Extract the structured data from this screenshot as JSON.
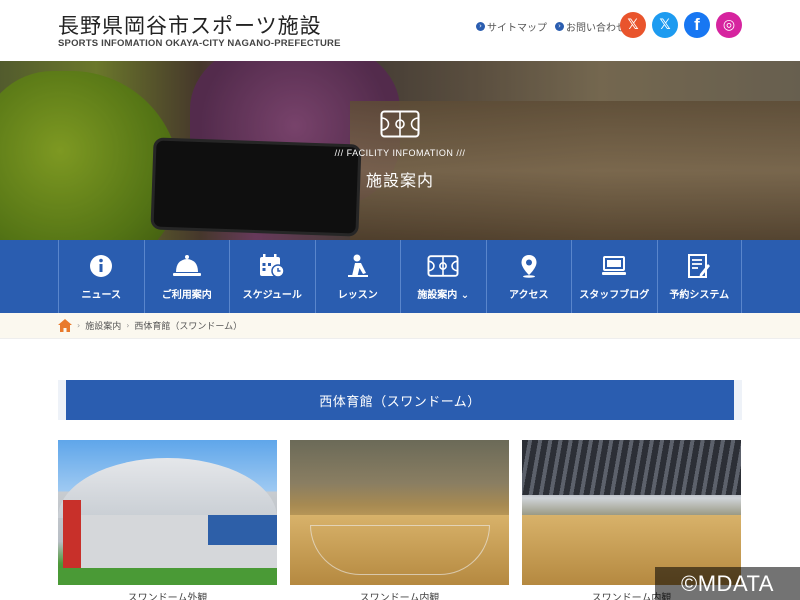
{
  "header": {
    "site_title": "長野県岡谷市スポーツ施設",
    "site_subtitle": "SPORTS INFOMATION OKAYA-CITY NAGANO-PREFECTURE",
    "links": [
      {
        "label": "サイトマップ"
      },
      {
        "label": "お問い合わせ"
      }
    ],
    "social": [
      {
        "icon": "x-icon",
        "glyph": "𝕏"
      },
      {
        "icon": "twitter-bird-icon",
        "glyph": "𝕏"
      },
      {
        "icon": "facebook-icon",
        "glyph": "f"
      },
      {
        "icon": "instagram-icon",
        "glyph": "◎"
      }
    ]
  },
  "hero": {
    "kicker": "FACILITY INFOMATION",
    "title": "施設案内"
  },
  "nav": {
    "items": [
      {
        "label": "ニュース",
        "icon": "info-icon"
      },
      {
        "label": "ご利用案内",
        "icon": "bell-icon"
      },
      {
        "label": "スケジュール",
        "icon": "calendar-icon"
      },
      {
        "label": "レッスン",
        "icon": "lesson-icon"
      },
      {
        "label": "施設案内",
        "icon": "court-icon"
      },
      {
        "label": "アクセス",
        "icon": "map-pin-icon"
      },
      {
        "label": "スタッフブログ",
        "icon": "computer-icon"
      },
      {
        "label": "予約システム",
        "icon": "reservation-icon"
      }
    ],
    "colors": {
      "background": "#2a5db0",
      "divider": "#5a86cc"
    }
  },
  "breadcrumb": {
    "items": [
      "施設案内",
      "西体育館（スワンドーム）"
    ],
    "separator": "›"
  },
  "section": {
    "title": "西体育館（スワンドーム）"
  },
  "photos": [
    {
      "caption": "スワンドーム外観"
    },
    {
      "caption": "スワンドーム内観"
    },
    {
      "caption": "スワンドーム内観"
    }
  ],
  "watermark": "©MDATA",
  "colors": {
    "accent": "#2a5db0",
    "breadcrumb_bg": "#fbf8ef",
    "home_icon": "#e97a2c"
  }
}
